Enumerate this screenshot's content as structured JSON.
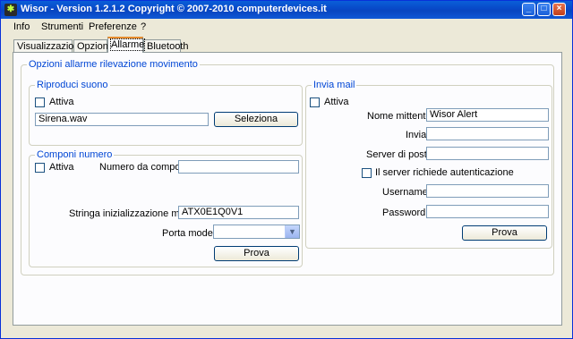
{
  "window": {
    "title": "Wisor - Version 1.2.1.2 Copyright © 2007-2010 computerdevices.it"
  },
  "menu": {
    "items": [
      "Info",
      "Strumenti",
      "Preferenze",
      "?"
    ]
  },
  "tabs": [
    {
      "label": "Visualizzazione"
    },
    {
      "label": "Opzioni"
    },
    {
      "label": "Allarme"
    },
    {
      "label": "Bluetooth"
    }
  ],
  "main": {
    "group_title": "Opzioni allarme rilevazione movimento",
    "sound": {
      "title": "Riproduci suono",
      "attiva_label": "Attiva",
      "file_value": "Sirena.wav",
      "select_button": "Seleziona"
    },
    "dial": {
      "title": "Componi numero",
      "attiva_label": "Attiva",
      "number_label": "Numero da comporre",
      "number_value": "",
      "init_label": "Stringa inizializzazione modem",
      "init_value": "ATX0E1Q0V1",
      "port_label": "Porta modem",
      "port_value": "",
      "test_button": "Prova"
    },
    "mail": {
      "title": "Invia mail",
      "attiva_label": "Attiva",
      "sender_label": "Nome mittente",
      "sender_value": "Wisor Alert",
      "to_label": "Invia a",
      "to_value": "",
      "server_label": "Server di posta",
      "server_value": "",
      "auth_label": "Il server richiede autenticazione",
      "user_label": "Username",
      "user_value": "",
      "pass_label": "Password",
      "pass_value": "",
      "test_button": "Prova"
    }
  }
}
